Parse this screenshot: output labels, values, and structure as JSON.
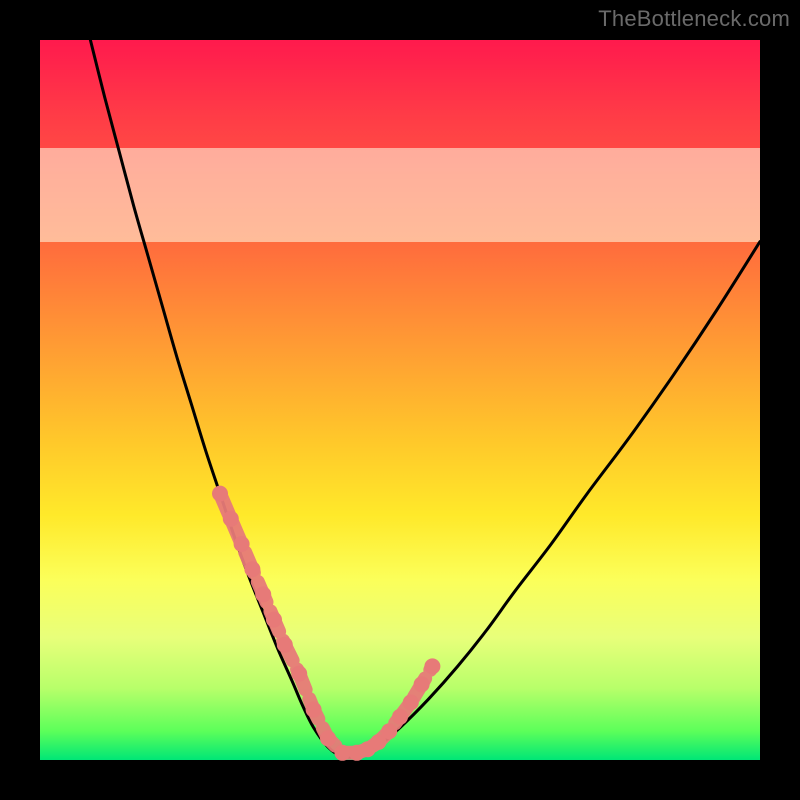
{
  "watermark": "TheBottleneck.com",
  "colors": {
    "frame": "#000000",
    "curve": "#000000",
    "marker_fill": "#e77a78",
    "marker_stroke": "#d95f5d"
  },
  "chart_data": {
    "type": "line",
    "title": "",
    "xlabel": "",
    "ylabel": "",
    "xlim": [
      0,
      100
    ],
    "ylim": [
      0,
      100
    ],
    "grid": false,
    "legend": false,
    "series": [
      {
        "name": "bottleneck-curve",
        "x": [
          7,
          9,
          11,
          13,
          15,
          17,
          19,
          21,
          23,
          25,
          27,
          29,
          31,
          33,
          35,
          36.5,
          38,
          40,
          42,
          44,
          47,
          50,
          54,
          58,
          62,
          66,
          71,
          76,
          82,
          88,
          94,
          100
        ],
        "y": [
          100,
          92,
          84.5,
          77,
          70,
          63,
          56,
          49.5,
          43,
          37,
          31,
          25.5,
          20.5,
          15.5,
          11,
          7.5,
          4.5,
          1.8,
          0.5,
          0.6,
          2,
          4.5,
          8.5,
          13,
          18,
          23.5,
          30,
          37,
          45,
          53.5,
          62.5,
          72
        ]
      }
    ],
    "markers": {
      "name": "highlighted-points",
      "x": [
        25,
        26.5,
        28,
        29.5,
        31,
        32.5,
        34,
        36,
        38,
        40,
        42,
        44,
        45.5,
        47,
        48.5,
        50,
        51.5,
        53,
        54.5
      ],
      "y": [
        37,
        33.5,
        30,
        26.5,
        23,
        19.5,
        16,
        12,
        7,
        3,
        1,
        1,
        1.5,
        2.5,
        4,
        6,
        8,
        10.5,
        13
      ]
    },
    "pale_band_y": [
      72,
      85
    ]
  }
}
